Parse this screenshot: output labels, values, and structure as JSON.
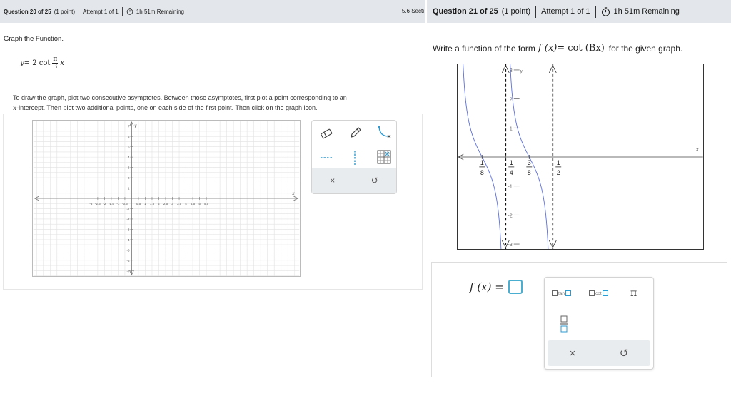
{
  "left": {
    "header": {
      "question": "Question 20 of 25",
      "points": "(1 point)",
      "attempt": "Attempt 1 of 1",
      "timer": "1h 51m Remaining",
      "section": "5.6 Secti"
    },
    "prompt": "Graph the Function.",
    "formula": {
      "lhs": "y",
      "eq": "= 2 cot",
      "num": "π",
      "den": "3",
      "var": "x"
    },
    "instructions_line1": "To draw the graph, plot two consecutive asymptotes. Between those asymptotes, first plot a point corresponding to an",
    "instructions_line2_var": "x",
    "instructions_line2_rest": "-intercept. Then plot two additional points, one on each side of the first point. Then click on the graph icon.",
    "grid": {
      "x_label": "x",
      "y_label": "y",
      "x_ticks": [
        "-3",
        "-2.5",
        "-2",
        "-1.5",
        "-1",
        "-0.5",
        "0.5",
        "1",
        "1.5",
        "2",
        "2.5",
        "3",
        "3.5",
        "4",
        "4.5",
        "5",
        "5.5"
      ],
      "y_ticks_pos": [
        "7",
        "6",
        "5",
        "4",
        "3",
        "2",
        "1"
      ],
      "y_ticks_neg": [
        "-1",
        "-2",
        "-3",
        "-4",
        "-5",
        "-6",
        "-7"
      ]
    },
    "tools": {
      "clear": "×",
      "undo": "↺"
    }
  },
  "right": {
    "header": {
      "question": "Question 21 of 25",
      "points": "(1 point)",
      "attempt": "Attempt 1 of 1",
      "timer": "1h 51m Remaining"
    },
    "prompt": "Write a function of the form",
    "form_fx": "f (x)",
    "form_eq": "= cot (Bx)",
    "prompt_end": "for the given graph.",
    "graph": {
      "x_label": "x",
      "y_label": "y",
      "y_ticks": [
        "3",
        "2",
        "1",
        "-1",
        "-2",
        "-3"
      ],
      "x_ticks": [
        {
          "num": "1",
          "den": "8"
        },
        {
          "num": "1",
          "den": "4"
        },
        {
          "num": "3",
          "den": "8"
        },
        {
          "num": "1",
          "den": "2"
        }
      ]
    },
    "answer_label": "f (x) =",
    "palette": {
      "tan": "tan",
      "cot": "cot",
      "pi": "π",
      "clear": "×",
      "undo": "↺"
    }
  }
}
